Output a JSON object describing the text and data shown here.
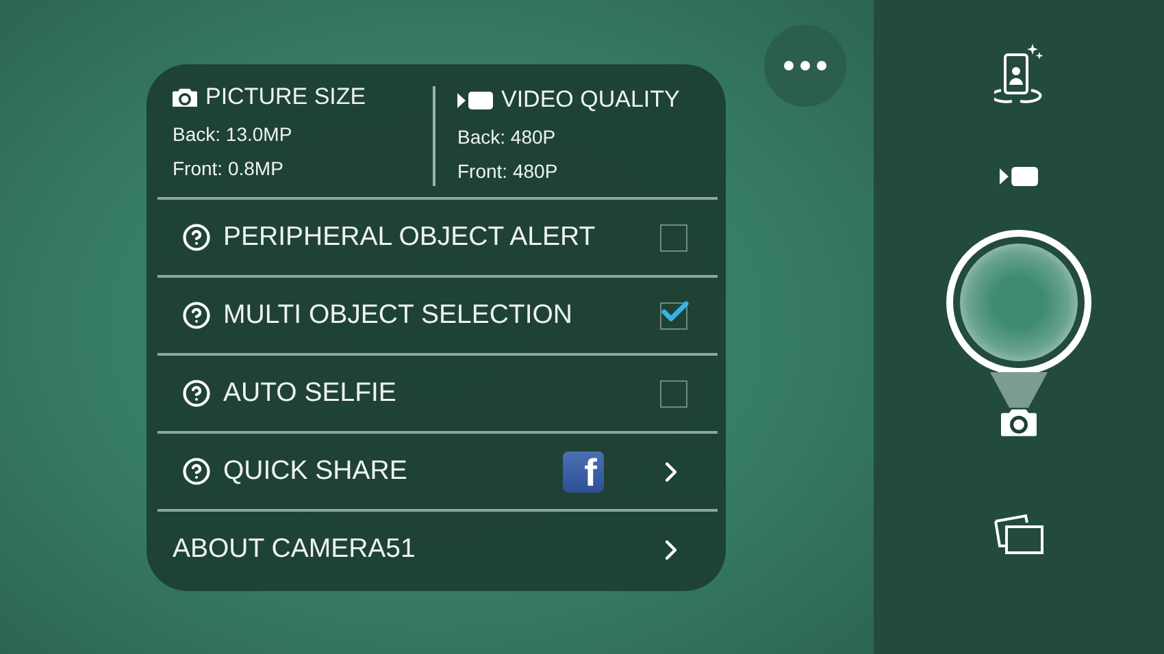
{
  "settings_card": {
    "header": [
      {
        "kind": "picture",
        "title": "PICTURE SIZE",
        "lines": [
          "Back: 13.0MP",
          "Front: 0.8MP"
        ]
      },
      {
        "kind": "video",
        "title": "VIDEO QUALITY",
        "lines": [
          "Back: 480P",
          "Front: 480P"
        ]
      }
    ],
    "rows": [
      {
        "kind": "checkbox",
        "label": "PERIPHERAL OBJECT ALERT",
        "help": true,
        "checked": false
      },
      {
        "kind": "checkbox",
        "label": "MULTI OBJECT SELECTION",
        "help": true,
        "checked": true
      },
      {
        "kind": "checkbox",
        "label": "AUTO SELFIE",
        "help": true,
        "checked": false
      },
      {
        "kind": "link",
        "label": "QUICK SHARE",
        "help": true,
        "logo_letter": "f"
      },
      {
        "kind": "link",
        "label": "ABOUT CAMERA51",
        "help": false
      }
    ]
  }
}
